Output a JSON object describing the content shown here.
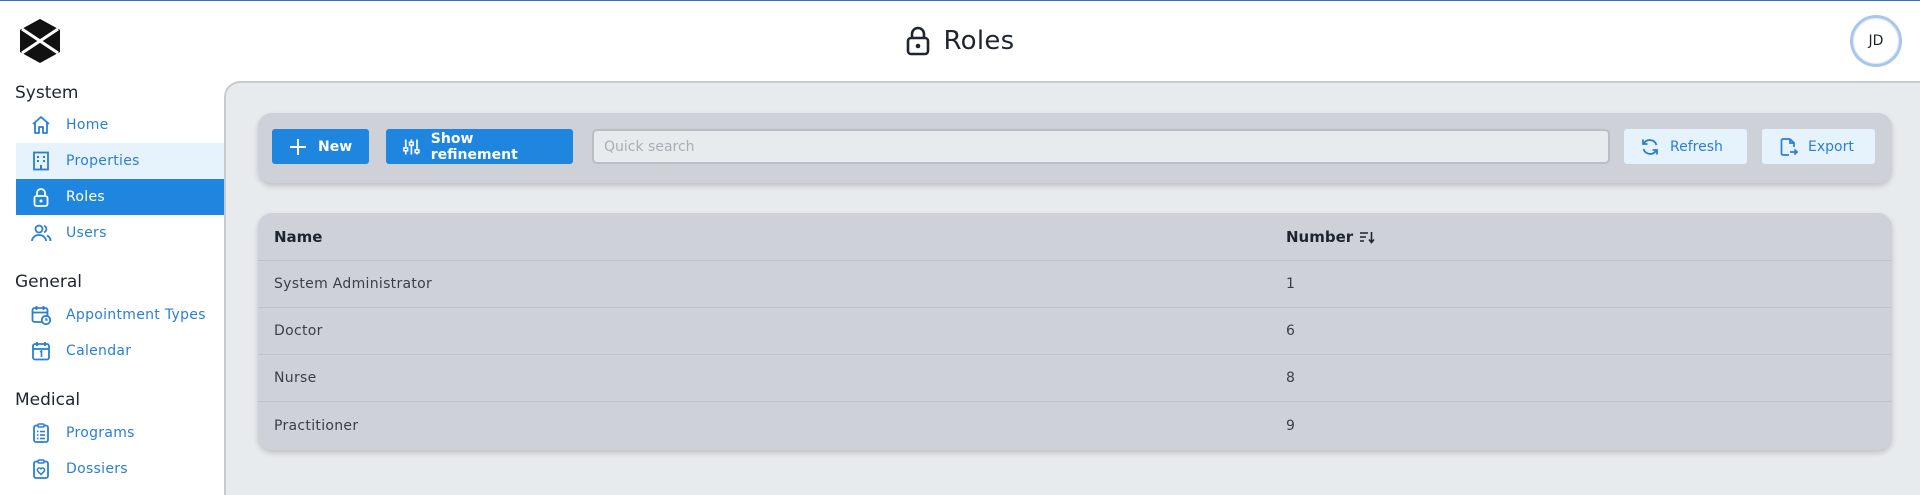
{
  "header": {
    "title": "Roles",
    "avatar_initials": "JD"
  },
  "sidebar": {
    "sections": [
      {
        "title": "System",
        "items": [
          {
            "label": "Home",
            "icon": "home-icon"
          },
          {
            "label": "Properties",
            "icon": "building-icon"
          },
          {
            "label": "Roles",
            "icon": "lock-icon"
          },
          {
            "label": "Users",
            "icon": "users-icon"
          }
        ]
      },
      {
        "title": "General",
        "items": [
          {
            "label": "Appointment Types",
            "icon": "calendar-clock-icon"
          },
          {
            "label": "Calendar",
            "icon": "calendar-icon"
          }
        ]
      },
      {
        "title": "Medical",
        "items": [
          {
            "label": "Programs",
            "icon": "clipboard-list-icon"
          },
          {
            "label": "Dossiers",
            "icon": "clipboard-heart-icon"
          }
        ]
      }
    ],
    "active_item": "Roles"
  },
  "toolbar": {
    "new_label": "New",
    "refinement_label": "Show refinement",
    "search_placeholder": "Quick search",
    "search_value": "",
    "refresh_label": "Refresh",
    "export_label": "Export"
  },
  "table": {
    "columns": [
      "Name",
      "Number"
    ],
    "sorted_column": "Number",
    "rows": [
      {
        "name": "System Administrator",
        "number": "1"
      },
      {
        "name": "Doctor",
        "number": "6"
      },
      {
        "name": "Nurse",
        "number": "8"
      },
      {
        "name": "Practitioner",
        "number": "9"
      }
    ]
  },
  "colors": {
    "accent": "#1f86e0",
    "accent_light": "#e6f2fc",
    "content_bg": "#e8ebee",
    "panel_bg": "#ced2d8"
  }
}
